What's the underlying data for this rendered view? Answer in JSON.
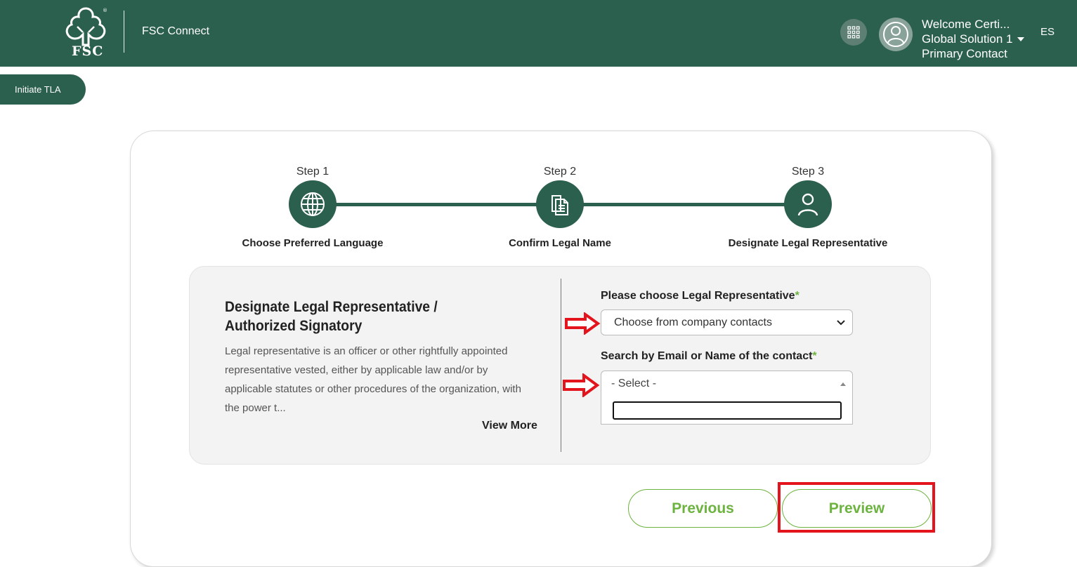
{
  "header": {
    "logo_text": "FSC",
    "app_name": "FSC Connect",
    "apps_icon": "grid-icon",
    "avatar_icon": "user-avatar-icon",
    "user_lines": [
      "Welcome Certi...",
      "Global Solution 1",
      "Primary Contact"
    ],
    "language": "ES"
  },
  "initiate_tab": {
    "label": "Initiate TLA"
  },
  "stepper": {
    "steps": [
      {
        "title": "Step 1",
        "label": "Choose Preferred Language",
        "icon": "globe-icon"
      },
      {
        "title": "Step 2",
        "label": "Confirm Legal Name",
        "icon": "document-icon"
      },
      {
        "title": "Step 3",
        "label": "Designate Legal Representative",
        "icon": "person-icon"
      }
    ]
  },
  "panel": {
    "title": "Designate Legal Representative / Authorized Signatory",
    "description": "Legal representative is an officer or other rightfully appointed representative vested, either by applicable law and/or by applicable statutes or other procedures of the organization, with the power t...",
    "view_more": "View More"
  },
  "form": {
    "rep_label": "Please choose Legal Representative",
    "rep_value": "Choose from company contacts",
    "search_label": "Search by Email or Name of the contact",
    "search_value": "- Select -",
    "required_mark": "*"
  },
  "buttons": {
    "previous": "Previous",
    "preview": "Preview"
  },
  "colors": {
    "brand_green": "#2b5f4e",
    "accent_green": "#6cb33f",
    "annotation_red": "#e3141c"
  }
}
